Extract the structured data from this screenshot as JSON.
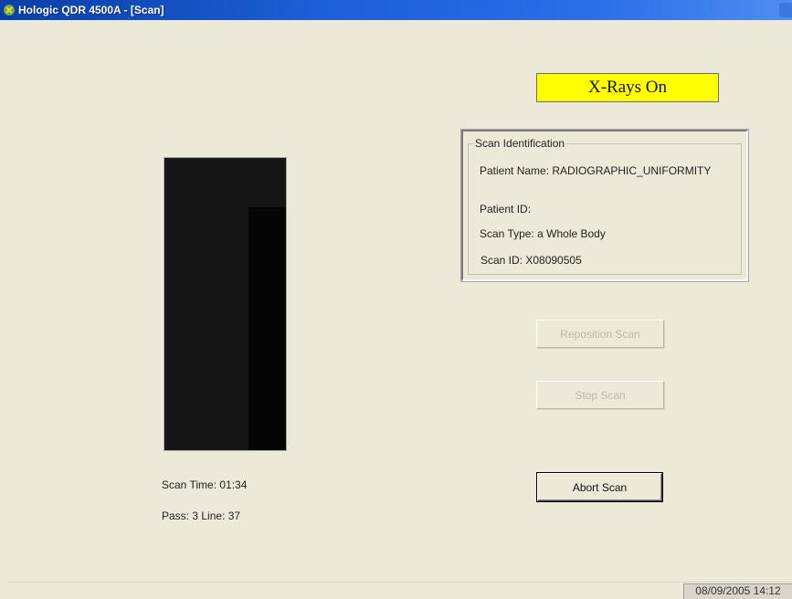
{
  "window": {
    "title": "Hologic QDR 4500A - [Scan]",
    "app_icon": "hologic-app-icon"
  },
  "xray_indicator": {
    "label": "X-Rays On",
    "color": "#ffff00"
  },
  "scan_identification": {
    "legend": "Scan Identification",
    "patient_name": "Patient Name:  RADIOGRAPHIC_UNIFORMITY",
    "patient_id": "Patient ID:",
    "scan_type": "Scan Type:  a Whole Body",
    "scan_id": "Scan ID:  X08090505"
  },
  "buttons": {
    "reposition": "Reposition Scan",
    "stop": "Stop Scan",
    "abort": "Abort Scan"
  },
  "scan_status": {
    "scan_time": "Scan Time:  01:34",
    "pass_line": "Pass:  3   Line:  37"
  },
  "statusbar": {
    "timestamp": "08/09/2005 14:12"
  }
}
